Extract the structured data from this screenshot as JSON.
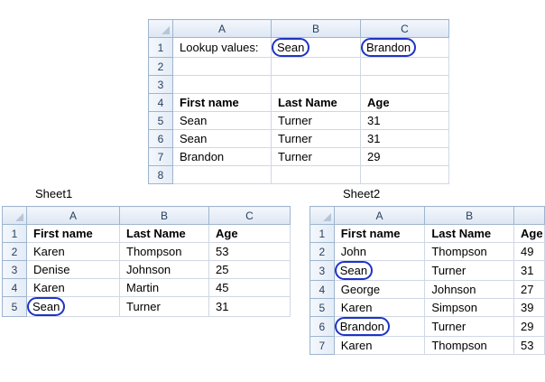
{
  "top": {
    "columns": [
      "A",
      "B",
      "C"
    ],
    "rows": [
      {
        "num": "1",
        "cells": [
          "Lookup values:",
          "Sean",
          "Brandon"
        ],
        "circled": [
          false,
          true,
          true
        ]
      },
      {
        "num": "2",
        "cells": [
          "",
          "",
          ""
        ],
        "circled": [
          false,
          false,
          false
        ]
      },
      {
        "num": "3",
        "cells": [
          "",
          "",
          ""
        ],
        "circled": [
          false,
          false,
          false
        ]
      },
      {
        "num": "4",
        "cells": [
          "First name",
          "Last Name",
          "Age"
        ],
        "circled": [
          false,
          false,
          false
        ]
      },
      {
        "num": "5",
        "cells": [
          "Sean",
          "Turner",
          "31"
        ],
        "circled": [
          false,
          false,
          false
        ]
      },
      {
        "num": "6",
        "cells": [
          "Sean",
          "Turner",
          "31"
        ],
        "circled": [
          false,
          false,
          false
        ]
      },
      {
        "num": "7",
        "cells": [
          "Brandon",
          "Turner",
          "29"
        ],
        "circled": [
          false,
          false,
          false
        ]
      },
      {
        "num": "8",
        "cells": [
          "",
          "",
          ""
        ],
        "circled": [
          false,
          false,
          false
        ]
      }
    ]
  },
  "sheet1": {
    "label": "Sheet1",
    "columns": [
      "A",
      "B",
      "C"
    ],
    "rows": [
      {
        "num": "1",
        "cells": [
          "First name",
          "Last Name",
          "Age"
        ],
        "circled": [
          false,
          false,
          false
        ]
      },
      {
        "num": "2",
        "cells": [
          "Karen",
          "Thompson",
          "53"
        ],
        "circled": [
          false,
          false,
          false
        ]
      },
      {
        "num": "3",
        "cells": [
          "Denise",
          "Johnson",
          "25"
        ],
        "circled": [
          false,
          false,
          false
        ]
      },
      {
        "num": "4",
        "cells": [
          "Karen",
          "Martin",
          "45"
        ],
        "circled": [
          false,
          false,
          false
        ]
      },
      {
        "num": "5",
        "cells": [
          "Sean",
          "Turner",
          "31"
        ],
        "circled": [
          true,
          false,
          false
        ]
      }
    ]
  },
  "sheet2": {
    "label": "Sheet2",
    "columns": [
      "A",
      "B",
      ""
    ],
    "rows": [
      {
        "num": "1",
        "cells": [
          "First name",
          "Last Name",
          "Age"
        ],
        "circled": [
          false,
          false,
          false
        ]
      },
      {
        "num": "2",
        "cells": [
          "John",
          "Thompson",
          "49"
        ],
        "circled": [
          false,
          false,
          false
        ]
      },
      {
        "num": "3",
        "cells": [
          "Sean",
          "Turner",
          "31"
        ],
        "circled": [
          true,
          false,
          false
        ]
      },
      {
        "num": "4",
        "cells": [
          "George",
          "Johnson",
          "27"
        ],
        "circled": [
          false,
          false,
          false
        ]
      },
      {
        "num": "5",
        "cells": [
          "Karen",
          "Simpson",
          "39"
        ],
        "circled": [
          false,
          false,
          false
        ]
      },
      {
        "num": "6",
        "cells": [
          "Brandon",
          "Turner",
          "29"
        ],
        "circled": [
          true,
          false,
          false
        ]
      },
      {
        "num": "7",
        "cells": [
          "Karen",
          "Thompson",
          "53"
        ],
        "circled": [
          false,
          false,
          false
        ]
      }
    ]
  }
}
